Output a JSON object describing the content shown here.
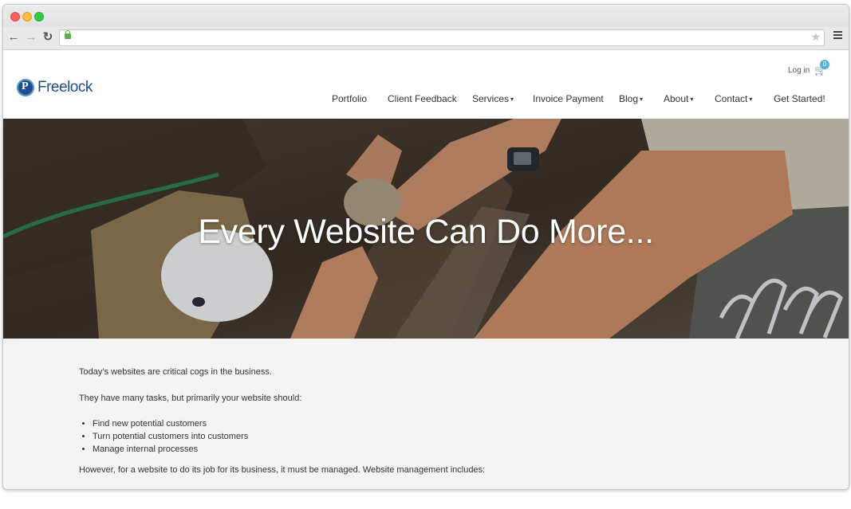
{
  "browser": {
    "url": "",
    "icons": {
      "back": "arrow-left-icon",
      "forward": "arrow-right-icon",
      "reload": "reload-icon",
      "lock": "lock-icon",
      "bookmark": "star-icon",
      "menu": "hamburger-menu-icon"
    }
  },
  "site": {
    "logo_text": "Freelock",
    "login_label": "Log in",
    "cart_count": "0",
    "nav": [
      {
        "label": "Portfolio",
        "dropdown": false
      },
      {
        "label": "Client Feedback",
        "dropdown": false
      },
      {
        "label": "Services",
        "dropdown": true
      },
      {
        "label": "Invoice Payment",
        "dropdown": false
      },
      {
        "label": "Blog",
        "dropdown": true
      },
      {
        "label": "About",
        "dropdown": true
      },
      {
        "label": "Contact",
        "dropdown": true
      },
      {
        "label": "Get Started!",
        "dropdown": false
      }
    ]
  },
  "hero": {
    "title": "Every Website Can Do More..."
  },
  "content": {
    "p1": "Today’s websites are critical cogs in the business.",
    "p2": "They have many tasks, but primarily your website should:",
    "bullets": [
      "Find new potential customers",
      "Turn potential customers into customers",
      "Manage internal processes"
    ],
    "p3": "However, for a website to do its job for its business, it must be managed. Website management includes:"
  },
  "colors": {
    "brand": "#1e4d8c",
    "cart_badge": "#5bb0d9",
    "content_bg": "#f4f4f4"
  }
}
